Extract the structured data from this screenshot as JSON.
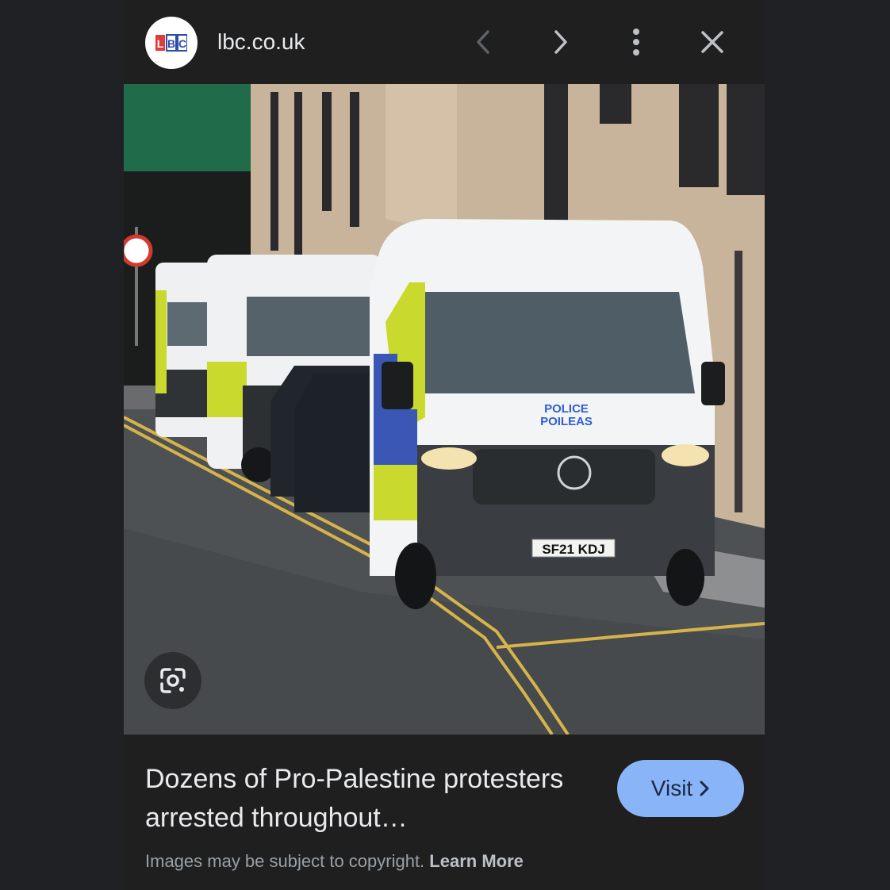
{
  "header": {
    "favicon_text": "LBC",
    "site_name": "lbc.co.uk",
    "prev_icon": "chevron-left-icon",
    "next_icon": "chevron-right-icon",
    "more_icon": "more-vert-icon",
    "close_icon": "close-icon"
  },
  "image": {
    "plate_text": "SF21 KDJ",
    "van_text_line1": "POLICE",
    "van_text_line2": "POILEAS",
    "lens_icon": "google-lens-icon"
  },
  "result": {
    "title": "Dozens of Pro-Palestine protesters arrested throughout…",
    "visit_label": "Visit",
    "copyright_text": "Images may be subject to copyright.",
    "learn_more_label": "Learn More"
  },
  "colors": {
    "background": "#202124",
    "panel": "#1f1f1f",
    "visit_button": "#8ab4f8",
    "text_primary": "#e8eaed",
    "text_secondary": "#9aa0a6"
  }
}
